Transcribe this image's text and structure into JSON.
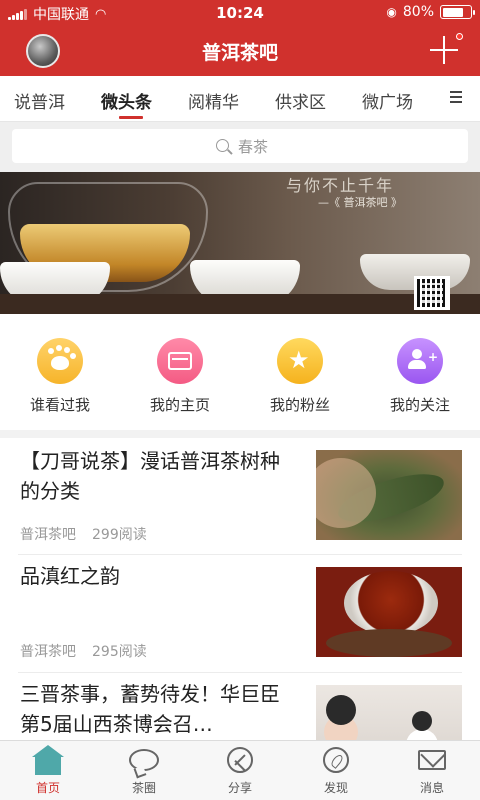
{
  "status_bar": {
    "carrier": "中国联通",
    "time": "10:24",
    "battery_text": "80%",
    "battery_level": 0.8
  },
  "header": {
    "title": "普洱茶吧"
  },
  "tabs": [
    {
      "label": "说普洱",
      "active": false
    },
    {
      "label": "微头条",
      "active": true
    },
    {
      "label": "阅精华",
      "active": false
    },
    {
      "label": "供求区",
      "active": false
    },
    {
      "label": "微广场",
      "active": false
    }
  ],
  "search": {
    "placeholder": "春茶"
  },
  "banner": {
    "quote_line": "与你不止千年",
    "quote_sign": "—《 普洱茶吧 》"
  },
  "quick_actions": [
    {
      "label": "谁看过我",
      "icon": "paw-icon",
      "color": "#f6b42a"
    },
    {
      "label": "我的主页",
      "icon": "card-icon",
      "color": "#f45b84"
    },
    {
      "label": "我的粉丝",
      "icon": "star-icon",
      "color": "#f5b21e"
    },
    {
      "label": "我的关注",
      "icon": "add-user-icon",
      "color": "#9a56f0"
    }
  ],
  "articles": [
    {
      "title": "【刀哥说茶】漫话普洱茶树种的分类",
      "source": "普洱茶吧",
      "reads": "299阅读",
      "thumb": "tea-leaf-image"
    },
    {
      "title": "品滇红之韵",
      "source": "普洱茶吧",
      "reads": "295阅读",
      "thumb": "red-tea-cup-image"
    },
    {
      "title": "三晋茶事，蓄势待发！华巨臣第5届山西茶博会召…",
      "source": "",
      "reads": "",
      "thumb": "children-event-image"
    }
  ],
  "bottom_nav": [
    {
      "label": "首页",
      "icon": "home-icon",
      "active": true
    },
    {
      "label": "茶圈",
      "icon": "chat-bubble-icon",
      "active": false
    },
    {
      "label": "分享",
      "icon": "share-icon",
      "active": false
    },
    {
      "label": "发现",
      "icon": "compass-icon",
      "active": false
    },
    {
      "label": "消息",
      "icon": "mail-icon",
      "active": false
    }
  ],
  "colors": {
    "brand_red": "#d0312d",
    "active_nav": "#d0312d",
    "home_icon": "#4fa8a9"
  }
}
